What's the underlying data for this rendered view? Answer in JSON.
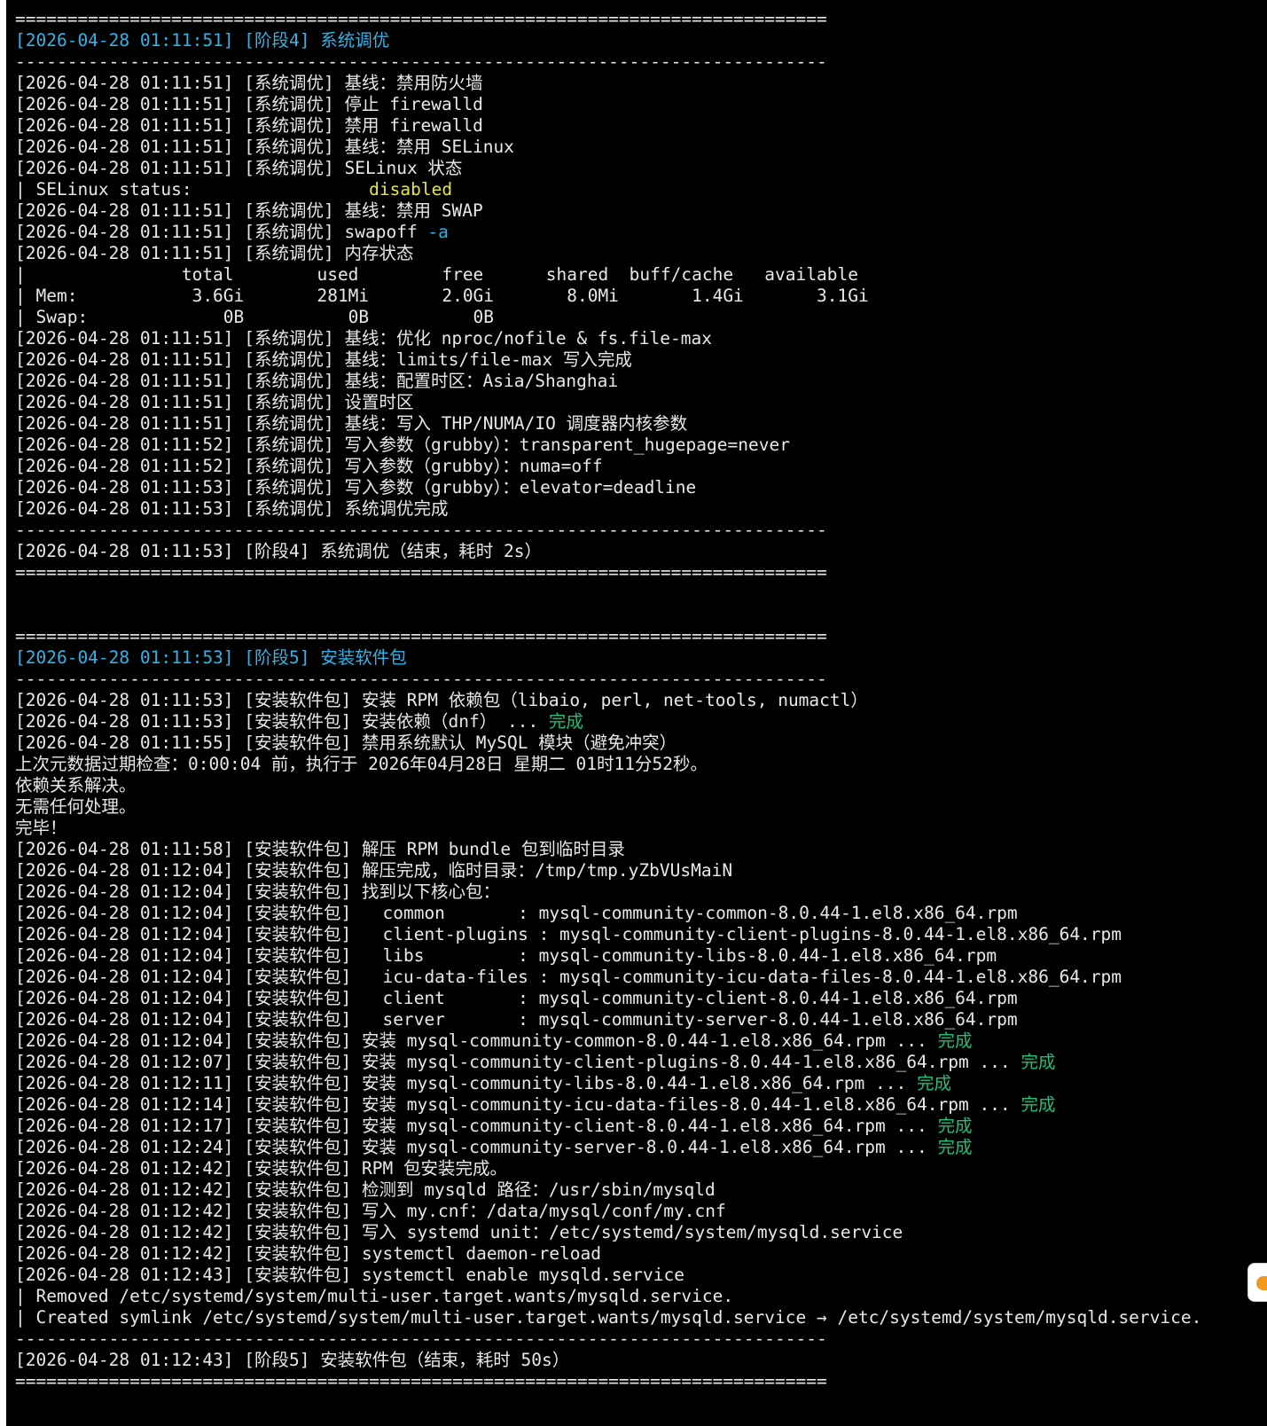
{
  "colors": {
    "background": "#000000",
    "text": "#e8e8e8",
    "cyan": "#2fb3e8",
    "yellow": "#e6e63c",
    "green": "#1ec07a",
    "handle_accent": "#f39a1e"
  },
  "icons": {
    "side_handle": "orange-tab-icon"
  },
  "lines": [
    {
      "segs": [
        {
          "t": "=============================================================================="
        }
      ]
    },
    {
      "segs": [
        {
          "t": "[2026-04-28 01:11:51] [阶段4] 系统调优",
          "c": "cyan"
        }
      ]
    },
    {
      "segs": [
        {
          "t": "------------------------------------------------------------------------------"
        }
      ]
    },
    {
      "segs": [
        {
          "t": "[2026-04-28 01:11:51] [系统调优] 基线：禁用防火墙"
        }
      ]
    },
    {
      "segs": [
        {
          "t": "[2026-04-28 01:11:51] [系统调优] 停止 firewalld"
        }
      ]
    },
    {
      "segs": [
        {
          "t": "[2026-04-28 01:11:51] [系统调优] 禁用 firewalld"
        }
      ]
    },
    {
      "segs": [
        {
          "t": "[2026-04-28 01:11:51] [系统调优] 基线：禁用 SELinux"
        }
      ]
    },
    {
      "segs": [
        {
          "t": "[2026-04-28 01:11:51] [系统调优] SELinux 状态"
        }
      ]
    },
    {
      "segs": [
        {
          "t": "| SELinux status:                 "
        },
        {
          "t": "disabled",
          "c": "yellow"
        }
      ]
    },
    {
      "segs": [
        {
          "t": "[2026-04-28 01:11:51] [系统调优] 基线：禁用 SWAP"
        }
      ]
    },
    {
      "segs": [
        {
          "t": "[2026-04-28 01:11:51] [系统调优] swapoff "
        },
        {
          "t": "-a",
          "c": "cyan"
        }
      ]
    },
    {
      "segs": [
        {
          "t": "[2026-04-28 01:11:51] [系统调优] 内存状态"
        }
      ]
    },
    {
      "segs": [
        {
          "t": "|               total        used        free      shared  buff/cache   available"
        }
      ]
    },
    {
      "segs": [
        {
          "t": "| Mem:           3.6Gi       281Mi       2.0Gi       8.0Mi       1.4Gi       3.1Gi"
        }
      ]
    },
    {
      "segs": [
        {
          "t": "| Swap:             0B          0B          0B"
        }
      ]
    },
    {
      "segs": [
        {
          "t": "[2026-04-28 01:11:51] [系统调优] 基线：优化 nproc/nofile & fs.file-max"
        }
      ]
    },
    {
      "segs": [
        {
          "t": "[2026-04-28 01:11:51] [系统调优] 基线：limits/file-max 写入完成"
        }
      ]
    },
    {
      "segs": [
        {
          "t": "[2026-04-28 01:11:51] [系统调优] 基线：配置时区：Asia/Shanghai"
        }
      ]
    },
    {
      "segs": [
        {
          "t": "[2026-04-28 01:11:51] [系统调优] 设置时区"
        }
      ]
    },
    {
      "segs": [
        {
          "t": "[2026-04-28 01:11:51] [系统调优] 基线：写入 THP/NUMA/IO 调度器内核参数"
        }
      ]
    },
    {
      "segs": [
        {
          "t": "[2026-04-28 01:11:52] [系统调优] 写入参数（grubby）：transparent_hugepage=never"
        }
      ]
    },
    {
      "segs": [
        {
          "t": "[2026-04-28 01:11:52] [系统调优] 写入参数（grubby）：numa=off"
        }
      ]
    },
    {
      "segs": [
        {
          "t": "[2026-04-28 01:11:53] [系统调优] 写入参数（grubby）：elevator=deadline"
        }
      ]
    },
    {
      "segs": [
        {
          "t": "[2026-04-28 01:11:53] [系统调优] 系统调优完成"
        }
      ]
    },
    {
      "segs": [
        {
          "t": "------------------------------------------------------------------------------"
        }
      ]
    },
    {
      "segs": [
        {
          "t": "[2026-04-28 01:11:53] [阶段4] 系统调优（结束，耗时 2s）"
        }
      ]
    },
    {
      "segs": [
        {
          "t": "=============================================================================="
        }
      ]
    },
    {
      "segs": [
        {
          "t": ""
        }
      ]
    },
    {
      "segs": [
        {
          "t": ""
        }
      ]
    },
    {
      "segs": [
        {
          "t": "=============================================================================="
        }
      ]
    },
    {
      "segs": [
        {
          "t": "[2026-04-28 01:11:53] [阶段5] 安装软件包",
          "c": "cyan"
        }
      ]
    },
    {
      "segs": [
        {
          "t": "------------------------------------------------------------------------------"
        }
      ]
    },
    {
      "segs": [
        {
          "t": "[2026-04-28 01:11:53] [安装软件包] 安装 RPM 依赖包（libaio, perl, net-tools, numactl）"
        }
      ]
    },
    {
      "segs": [
        {
          "t": "[2026-04-28 01:11:53] [安装软件包] 安装依赖（dnf） ... "
        },
        {
          "t": "完成",
          "c": "green"
        }
      ]
    },
    {
      "segs": [
        {
          "t": "[2026-04-28 01:11:55] [安装软件包] 禁用系统默认 MySQL 模块（避免冲突）"
        }
      ]
    },
    {
      "segs": [
        {
          "t": "上次元数据过期检查：0:00:04 前，执行于 2026年04月28日 星期二 01时11分52秒。"
        }
      ]
    },
    {
      "segs": [
        {
          "t": "依赖关系解决。"
        }
      ]
    },
    {
      "segs": [
        {
          "t": "无需任何处理。"
        }
      ]
    },
    {
      "segs": [
        {
          "t": "完毕！"
        }
      ]
    },
    {
      "segs": [
        {
          "t": "[2026-04-28 01:11:58] [安装软件包] 解压 RPM bundle 包到临时目录"
        }
      ]
    },
    {
      "segs": [
        {
          "t": "[2026-04-28 01:12:04] [安装软件包] 解压完成，临时目录：/tmp/tmp.yZbVUsMaiN"
        }
      ]
    },
    {
      "segs": [
        {
          "t": "[2026-04-28 01:12:04] [安装软件包] 找到以下核心包："
        }
      ]
    },
    {
      "segs": [
        {
          "t": "[2026-04-28 01:12:04] [安装软件包]   common       : mysql-community-common-8.0.44-1.el8.x86_64.rpm"
        }
      ]
    },
    {
      "segs": [
        {
          "t": "[2026-04-28 01:12:04] [安装软件包]   client-plugins : mysql-community-client-plugins-8.0.44-1.el8.x86_64.rpm"
        }
      ]
    },
    {
      "segs": [
        {
          "t": "[2026-04-28 01:12:04] [安装软件包]   libs         : mysql-community-libs-8.0.44-1.el8.x86_64.rpm"
        }
      ]
    },
    {
      "segs": [
        {
          "t": "[2026-04-28 01:12:04] [安装软件包]   icu-data-files : mysql-community-icu-data-files-8.0.44-1.el8.x86_64.rpm"
        }
      ]
    },
    {
      "segs": [
        {
          "t": "[2026-04-28 01:12:04] [安装软件包]   client       : mysql-community-client-8.0.44-1.el8.x86_64.rpm"
        }
      ]
    },
    {
      "segs": [
        {
          "t": "[2026-04-28 01:12:04] [安装软件包]   server       : mysql-community-server-8.0.44-1.el8.x86_64.rpm"
        }
      ]
    },
    {
      "segs": [
        {
          "t": "[2026-04-28 01:12:04] [安装软件包] 安装 mysql-community-common-8.0.44-1.el8.x86_64.rpm ... "
        },
        {
          "t": "完成",
          "c": "green"
        }
      ]
    },
    {
      "segs": [
        {
          "t": "[2026-04-28 01:12:07] [安装软件包] 安装 mysql-community-client-plugins-8.0.44-1.el8.x86_64.rpm ... "
        },
        {
          "t": "完成",
          "c": "green"
        }
      ]
    },
    {
      "segs": [
        {
          "t": "[2026-04-28 01:12:11] [安装软件包] 安装 mysql-community-libs-8.0.44-1.el8.x86_64.rpm ... "
        },
        {
          "t": "完成",
          "c": "green"
        }
      ]
    },
    {
      "segs": [
        {
          "t": "[2026-04-28 01:12:14] [安装软件包] 安装 mysql-community-icu-data-files-8.0.44-1.el8.x86_64.rpm ... "
        },
        {
          "t": "完成",
          "c": "green"
        }
      ]
    },
    {
      "segs": [
        {
          "t": "[2026-04-28 01:12:17] [安装软件包] 安装 mysql-community-client-8.0.44-1.el8.x86_64.rpm ... "
        },
        {
          "t": "完成",
          "c": "green"
        }
      ]
    },
    {
      "segs": [
        {
          "t": "[2026-04-28 01:12:24] [安装软件包] 安装 mysql-community-server-8.0.44-1.el8.x86_64.rpm ... "
        },
        {
          "t": "完成",
          "c": "green"
        }
      ]
    },
    {
      "segs": [
        {
          "t": "[2026-04-28 01:12:42] [安装软件包] RPM 包安装完成。"
        }
      ]
    },
    {
      "segs": [
        {
          "t": "[2026-04-28 01:12:42] [安装软件包] 检测到 mysqld 路径：/usr/sbin/mysqld"
        }
      ]
    },
    {
      "segs": [
        {
          "t": "[2026-04-28 01:12:42] [安装软件包] 写入 my.cnf：/data/mysql/conf/my.cnf"
        }
      ]
    },
    {
      "segs": [
        {
          "t": "[2026-04-28 01:12:42] [安装软件包] 写入 systemd unit：/etc/systemd/system/mysqld.service"
        }
      ]
    },
    {
      "segs": [
        {
          "t": "[2026-04-28 01:12:42] [安装软件包] systemctl daemon-reload"
        }
      ]
    },
    {
      "segs": [
        {
          "t": "[2026-04-28 01:12:43] [安装软件包] systemctl enable mysqld.service"
        }
      ]
    },
    {
      "segs": [
        {
          "t": "| Removed /etc/systemd/system/multi-user.target.wants/mysqld.service."
        }
      ]
    },
    {
      "segs": [
        {
          "t": "| Created symlink /etc/systemd/system/multi-user.target.wants/mysqld.service → /etc/systemd/system/mysqld.service."
        }
      ]
    },
    {
      "segs": [
        {
          "t": "------------------------------------------------------------------------------"
        }
      ]
    },
    {
      "segs": [
        {
          "t": "[2026-04-28 01:12:43] [阶段5] 安装软件包（结束，耗时 50s）"
        }
      ]
    },
    {
      "segs": [
        {
          "t": "=============================================================================="
        }
      ]
    }
  ]
}
